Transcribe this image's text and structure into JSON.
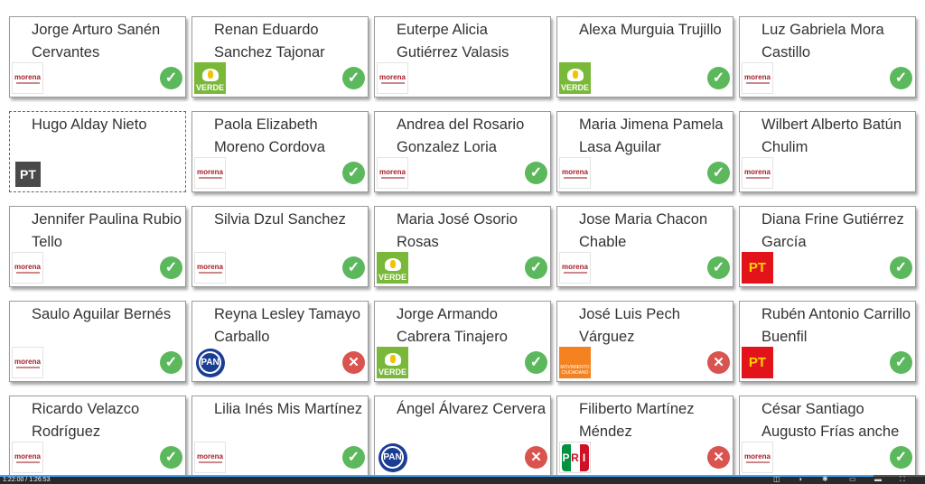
{
  "cards": [
    {
      "name": "Jorge Arturo Sanén Cervantes",
      "party": "morena",
      "vote": "approve"
    },
    {
      "name": "Renan Eduardo Sanchez Tajonar",
      "party": "verde",
      "vote": "approve"
    },
    {
      "name": "Euterpe Alicia Gutiérrez Valasis",
      "party": "morena",
      "vote": "none"
    },
    {
      "name": "Alexa Murguia Trujillo",
      "party": "verde",
      "vote": "approve"
    },
    {
      "name": "Luz Gabriela Mora Castillo",
      "party": "morena",
      "vote": "approve"
    },
    {
      "name": "Hugo Alday Nieto",
      "party": "pt-dark",
      "vote": "none",
      "dashed": true
    },
    {
      "name": "Paola Elizabeth Moreno Cordova",
      "party": "morena",
      "vote": "approve"
    },
    {
      "name": "Andrea del Rosario Gonzalez Loria",
      "party": "morena",
      "vote": "approve"
    },
    {
      "name": "Maria Jimena Pamela Lasa Aguilar",
      "party": "morena",
      "vote": "approve"
    },
    {
      "name": "Wilbert Alberto Batún Chulim",
      "party": "morena",
      "vote": "none"
    },
    {
      "name": "Jennifer Paulina Rubio Tello",
      "party": "morena",
      "vote": "approve"
    },
    {
      "name": "Silvia Dzul Sanchez",
      "party": "morena",
      "vote": "approve"
    },
    {
      "name": "Maria José Osorio Rosas",
      "party": "verde",
      "vote": "approve"
    },
    {
      "name": "Jose Maria Chacon Chable",
      "party": "morena",
      "vote": "approve"
    },
    {
      "name": "Diana Frine Gutiérrez García",
      "party": "pt-red",
      "vote": "approve"
    },
    {
      "name": "Saulo Aguilar Bernés",
      "party": "morena",
      "vote": "approve"
    },
    {
      "name": "Reyna Lesley Tamayo Carballo",
      "party": "pan",
      "vote": "reject"
    },
    {
      "name": "Jorge Armando Cabrera Tinajero",
      "party": "verde",
      "vote": "approve"
    },
    {
      "name": "José Luis Pech Várguez",
      "party": "mc",
      "vote": "reject"
    },
    {
      "name": "Rubén Antonio Carrillo Buenfil",
      "party": "pt-red",
      "vote": "approve"
    },
    {
      "name": "Ricardo Velazco Rodríguez",
      "party": "morena",
      "vote": "approve"
    },
    {
      "name": "Lilia Inés Mis Martínez",
      "party": "morena",
      "vote": "approve"
    },
    {
      "name": "Ángel Álvarez Cervera",
      "party": "pan",
      "vote": "reject"
    },
    {
      "name": "Filiberto Martínez Méndez",
      "party": "pri",
      "vote": "reject"
    },
    {
      "name": "César Santiago Augusto Frías anche",
      "party": "morena",
      "vote": "approve"
    }
  ],
  "logos": {
    "morena_text": "morena",
    "verde_text": "VERDE",
    "pt_text": "PT",
    "pan_text": "PAN",
    "mc_text": "MOVIMIENTO CIUDADANO",
    "pri_letters": [
      "P",
      "R",
      "I"
    ]
  },
  "icons": {
    "approve": "check-icon",
    "reject": "x-icon"
  },
  "colors": {
    "approve": "#5cb85c",
    "reject": "#d9534f",
    "morena": "#a51d28",
    "verde": "#7ab83a",
    "pt": "#e3131b",
    "pan": "#1b3e94",
    "mc": "#f58220"
  },
  "player": {
    "time": "1:22:00 / 1:26:53",
    "progress": 0.944
  }
}
